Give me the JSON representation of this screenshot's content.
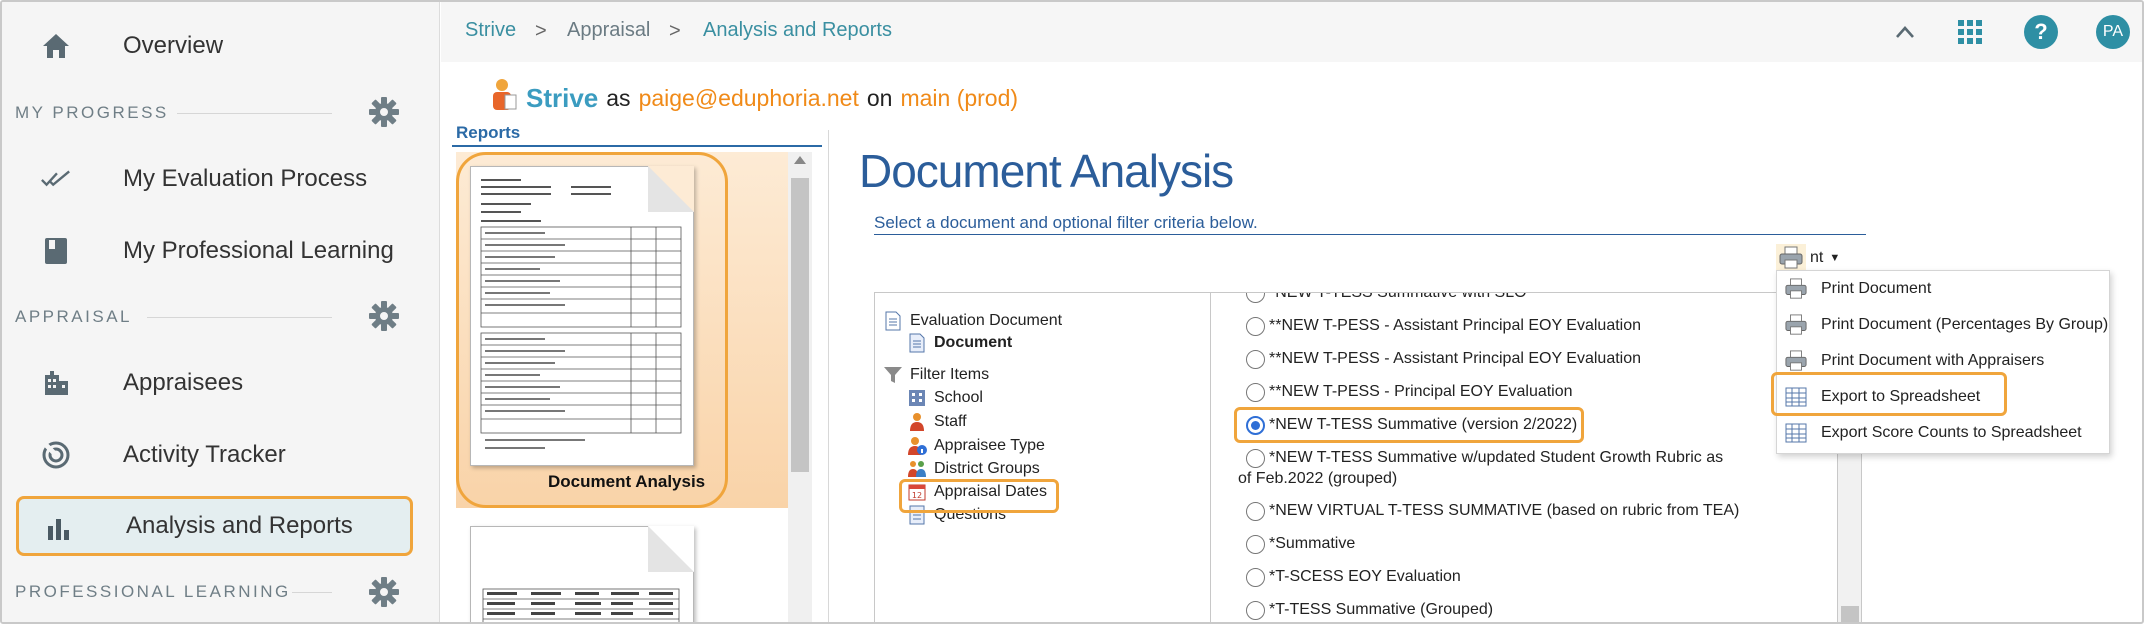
{
  "sidebar": {
    "overview_label": "Overview",
    "section_my_progress": "MY PROGRESS",
    "evaluation_process_label": "My Evaluation Process",
    "professional_learning_label": "My Professional Learning",
    "section_appraisal": "APPRAISAL",
    "appraisees_label": "Appraisees",
    "activity_tracker_label": "Activity Tracker",
    "analysis_reports_label": "Analysis and Reports",
    "section_professional_learning": "PROFESSIONAL LEARNING"
  },
  "breadcrumb": {
    "item1": "Strive",
    "item2": "Appraisal",
    "item3": "Analysis and Reports",
    "separator": ">"
  },
  "topbar": {
    "avatar_initials": "PA",
    "help_glyph": "?"
  },
  "banner": {
    "brand": "Strive",
    "as_word": "as",
    "user_email": "paige@eduphoria.net",
    "on_word": "on",
    "environment": "main (prod)"
  },
  "reports": {
    "heading": "Reports",
    "thumb1_label": "Document Analysis"
  },
  "document_analysis": {
    "title": "Document Analysis",
    "subtitle": "Select a document and optional filter criteria below."
  },
  "tree": {
    "evaluation_document": "Evaluation Document",
    "document": "Document",
    "filter_items": "Filter Items",
    "school": "School",
    "staff": "Staff",
    "appraisee_type": "Appraisee Type",
    "district_groups": "District Groups",
    "appraisal_dates": "Appraisal Dates",
    "questions": "Questions"
  },
  "documents": {
    "opt0": "*NEW T-TESS Summative with SLO",
    "opt1": "**NEW T-PESS - Assistant Principal EOY Evaluation",
    "opt2": "**NEW T-PESS - Assistant Principal EOY Evaluation",
    "opt3": "**NEW T-PESS - Principal EOY Evaluation",
    "opt4": "*NEW T-TESS Summative (version 2/2022)",
    "opt5_line1": "*NEW T-TESS Summative w/updated Student Growth Rubric as",
    "opt5_line2": "of Feb.2022 (grouped)",
    "opt6": "*NEW VIRTUAL T-TESS SUMMATIVE (based on rubric from TEA)",
    "opt7": "*Summative",
    "opt8": "*T-SCESS EOY Evaluation",
    "opt9": "*T-TESS Summative (Grouped)"
  },
  "print_menu": {
    "button_partial": "nt",
    "items": [
      "Print Document",
      "Print Document (Percentages By Group)",
      "Print Document with Appraisers",
      "Export to Spreadsheet",
      "Export Score Counts to Spreadsheet"
    ]
  },
  "colors": {
    "accent": "#2e8fa4",
    "highlight": "#f0a53c",
    "link": "#3a8fa1",
    "title_blue": "#2b5d9a",
    "brand_orange": "#f08a18"
  }
}
